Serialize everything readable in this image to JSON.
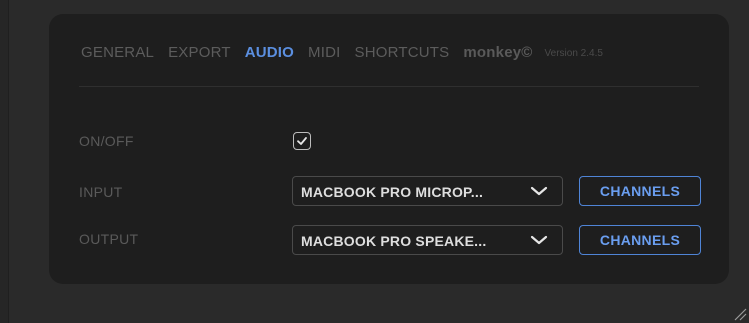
{
  "tabs": [
    {
      "label": "GENERAL",
      "active": false
    },
    {
      "label": "EXPORT",
      "active": false
    },
    {
      "label": "AUDIO",
      "active": true
    },
    {
      "label": "MIDI",
      "active": false
    },
    {
      "label": "SHORTCUTS",
      "active": false
    }
  ],
  "brand": "monkey©",
  "version": "Version 2.4.5",
  "settings": {
    "onoff": {
      "label": "ON/OFF",
      "checked": true
    },
    "input": {
      "label": "INPUT",
      "value": "MACBOOK PRO MICROP...",
      "button": "CHANNELS"
    },
    "output": {
      "label": "OUTPUT",
      "value": "MACBOOK PRO SPEAKE...",
      "button": "CHANNELS"
    }
  },
  "colors": {
    "accent": "#5b8fe0",
    "panel_bg": "#1e1e1e",
    "outer_bg": "#2a2a2a",
    "muted_text": "#5a5a5a"
  },
  "icons": {
    "check": "checkmark-icon",
    "chevron": "chevron-down-icon",
    "grip": "resize-grip-icon"
  }
}
